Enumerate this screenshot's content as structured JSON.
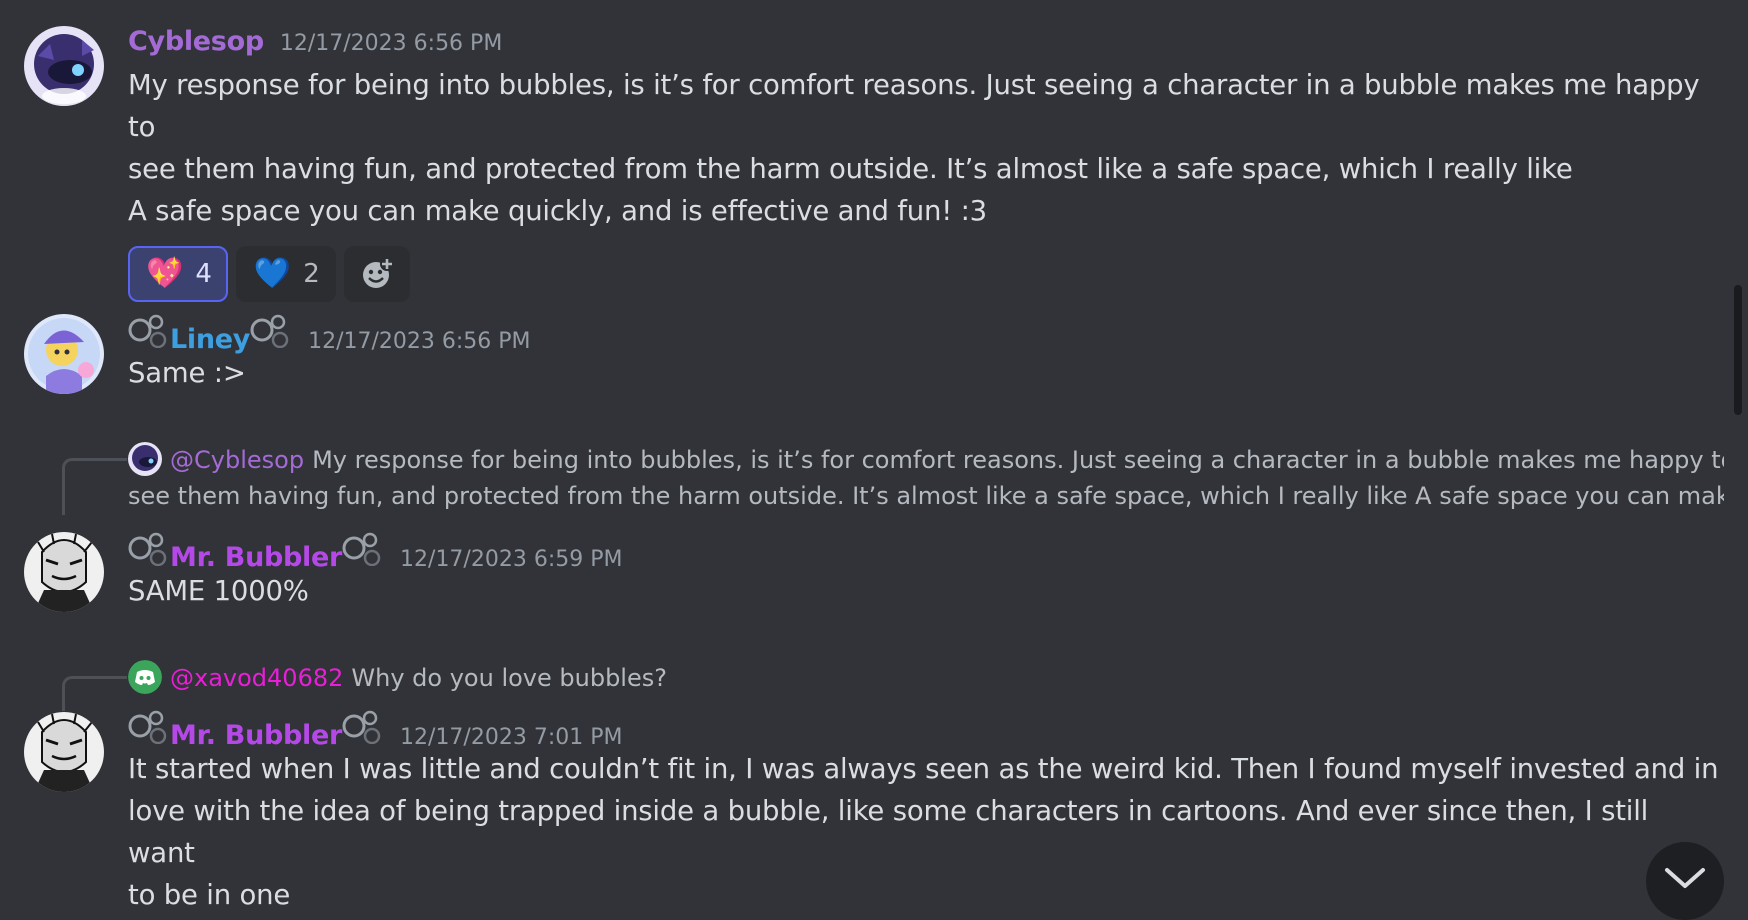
{
  "messages": [
    {
      "username": "Cyblesop",
      "name_color": "#a46bd6",
      "timestamp": "12/17/2023 6:56 PM",
      "lines": [
        "My response for being into bubbles, is it’s for comfort reasons. Just seeing a character in a bubble makes me happy to",
        "see them having fun, and protected from the harm outside. It’s almost like a safe space, which I really like",
        "A safe space you can make quickly, and is effective and fun! :3"
      ],
      "reactions": [
        {
          "emoji": "💖",
          "count": "4"
        },
        {
          "emoji": "💙",
          "count": "2"
        }
      ],
      "add_reaction_icon": "add-reaction-icon"
    },
    {
      "username": "Liney",
      "name_color": "#3d9ee0",
      "timestamp": "12/17/2023 6:56 PM",
      "text": "Same :>"
    },
    {
      "reply": {
        "mention": "@Cyblesop",
        "mention_color": "#a46bd6",
        "preview_line1": "My response for being into bubbles, is it’s for comfort reasons. Just seeing a character in a bubble makes me happy to",
        "preview_line2": "see them having fun, and protected from the harm outside. It’s almost like a safe space, which I really like A safe space you can make …"
      },
      "username": "Mr. Bubbler",
      "name_color": "#b549e8",
      "timestamp": "12/17/2023 6:59 PM",
      "text": "SAME 1000%"
    },
    {
      "reply": {
        "mention": "@xavod40682",
        "mention_color": "#e91ed8",
        "preview_line1": "Why do you love bubbles?"
      },
      "username": "Mr. Bubbler",
      "name_color": "#b549e8",
      "timestamp": "12/17/2023 7:01 PM",
      "lines": [
        "It started when I was little and couldn’t fit in, I was always seen as the weird kid. Then I found myself invested and in",
        "love with the idea of being trapped inside a bubble, like some characters in cartoons. And ever since then, I still want",
        "to be in one"
      ]
    }
  ],
  "colors": {
    "background": "#313338",
    "reaction_active_border": "#5865f2",
    "discord_green": "#3ba55c"
  },
  "icons": {
    "bubbles": "bubbles-icon",
    "jump": "chevron-down-icon",
    "discord": "discord-logo-icon"
  }
}
